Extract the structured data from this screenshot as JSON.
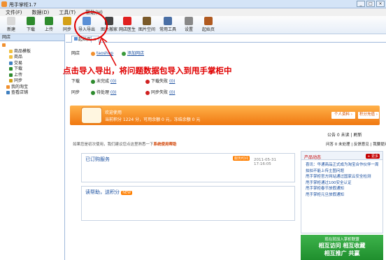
{
  "window": {
    "title": "甩手掌柜1.7"
  },
  "menu": [
    "文件(F)",
    "数据(D)",
    "工具(T)",
    "帮助(H)"
  ],
  "toolbar": [
    {
      "label": "新建",
      "icon": "new-icon",
      "color": "#d9d9d9"
    },
    {
      "label": "下载",
      "icon": "download-icon",
      "color": "#2e8b2e"
    },
    {
      "label": "上传",
      "icon": "upload-icon",
      "color": "#2e8b2e"
    },
    {
      "label": "同步",
      "icon": "sync-icon",
      "color": "#d4a017"
    },
    {
      "label": "导入导出",
      "icon": "import-export-icon",
      "color": "#5a8fd6"
    },
    {
      "label": "图片搬家",
      "icon": "image-move-icon",
      "color": "#444"
    },
    {
      "label": "网店医生",
      "icon": "doctor-icon",
      "color": "#e02020"
    },
    {
      "label": "图片空间",
      "icon": "image-space-icon",
      "color": "#7a5a2a"
    },
    {
      "label": "常用工具",
      "icon": "tools-icon",
      "color": "#4a6fa5"
    },
    {
      "label": "设置",
      "icon": "settings-icon",
      "color": "#888"
    },
    {
      "label": "起始页",
      "icon": "home-icon",
      "color": "#b05a20"
    }
  ],
  "sidebar": {
    "header": "网店",
    "items": [
      {
        "label": "",
        "color": "#f09030"
      },
      {
        "label": "商品模板",
        "color": "#f0c040"
      },
      {
        "label": "商品",
        "color": "#f0c040"
      },
      {
        "label": "交易",
        "color": "#4080c0"
      },
      {
        "label": "下载",
        "color": "#2e8b2e"
      },
      {
        "label": "上传",
        "color": "#2e8b2e"
      },
      {
        "label": "同步",
        "color": "#d4a017"
      },
      {
        "label": "我的淘宝",
        "color": "#f09030"
      },
      {
        "label": "查看店铺",
        "color": "#4080c0"
      }
    ]
  },
  "tabs": [
    "起始页",
    "x"
  ],
  "info": {
    "row1_label": "网店",
    "row1_link1": "taoshop",
    "row1_link2": "添加网店",
    "row2_label": "下载",
    "row2_a": "未完成",
    "row2_a_count": "(0)",
    "row2_b": "下载失败",
    "row2_b_count": "(0)",
    "row3_label": "同步",
    "row3_a": "待处理",
    "row3_a_count": "(0)",
    "row3_b": "同步失败",
    "row3_b_count": "(0)"
  },
  "account": {
    "welcome": "欢迎使用",
    "balance": "当前积分 1224 分，可用余额 0 元，冻结余额 0 元",
    "btn_profile": "个人资料 ›",
    "btn_recharge": "积分充值 ›"
  },
  "links_right": "公告 0 未读 | 刷新",
  "links_right2": "问答 0 未处理 | 反馈意见 | 我要提问",
  "hint": "如果您是初次使用，我们建议您点这里熟悉一下",
  "hint_link": "系统使用帮助",
  "ordered": {
    "title": "已订购服务",
    "badge": "服务时间",
    "date": "2011-05-31 17:16:05"
  },
  "help": {
    "title": "读帮助，送积分",
    "badge": "NEW"
  },
  "news": {
    "title": "产品动态",
    "more": "+ 更多",
    "items": [
      "喜讯：华通商品正式成为淘宝合作伙伴一周",
      "拍拍不能上传主图问题",
      "甩手掌柜官方网站通过国家云安全检测",
      "甩手掌柜通过100安全认证",
      "甩手掌柜春节放假通知",
      "甩手掌柜元旦放假通知"
    ]
  },
  "promo": {
    "line1": "现在就加入掌柜联盟",
    "line2": "相互访问  相互收藏",
    "line3": "相互推广 共赢"
  },
  "annotation": "点击导入导出，将问题数据包导入到甩手掌柜中"
}
